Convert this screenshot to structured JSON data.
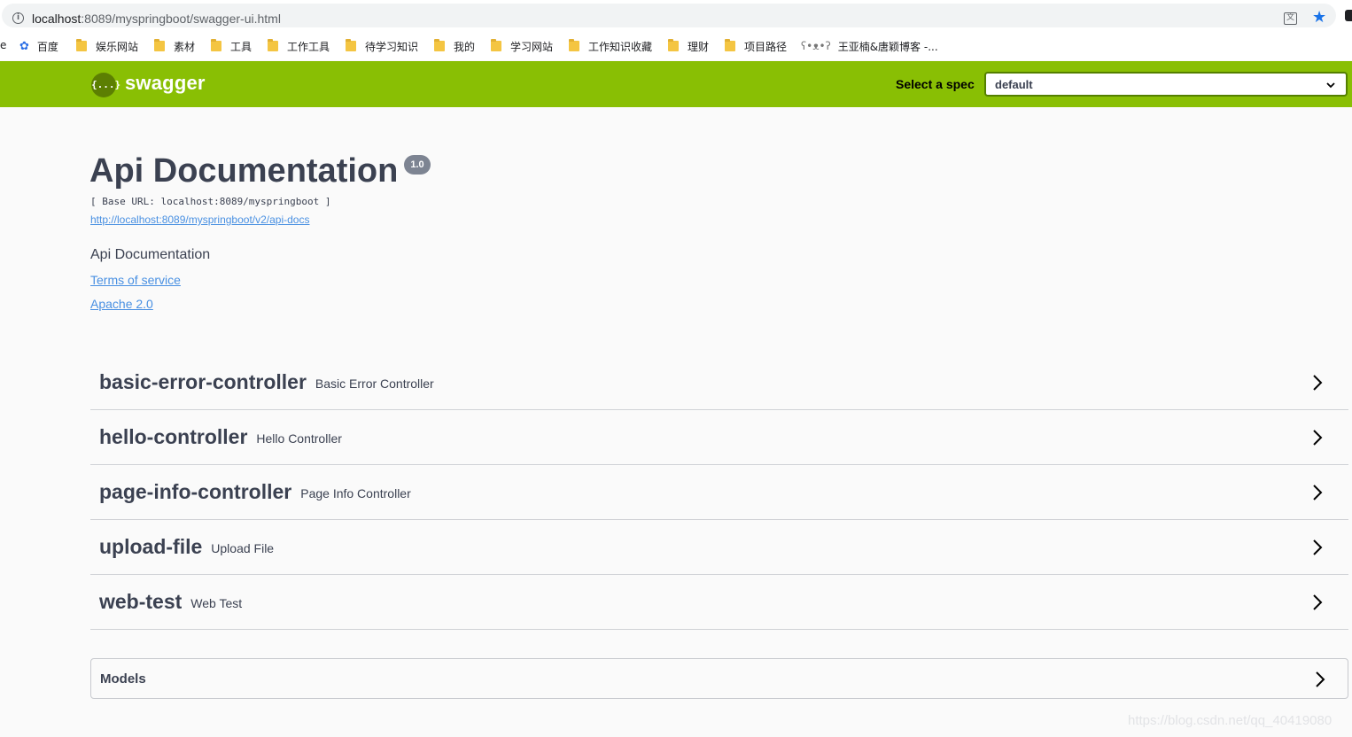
{
  "browser": {
    "url_host": "localhost",
    "url_path": ":8089/myspringboot/swagger-ui.html",
    "bookmark_edge": "e",
    "bookmarks": [
      {
        "label": "百度",
        "icon": "paw-icon"
      },
      {
        "label": "娱乐网站",
        "icon": "folder-icon"
      },
      {
        "label": "素材",
        "icon": "folder-icon"
      },
      {
        "label": "工具",
        "icon": "folder-icon"
      },
      {
        "label": "工作工具",
        "icon": "folder-icon"
      },
      {
        "label": "待学习知识",
        "icon": "folder-icon"
      },
      {
        "label": "我的",
        "icon": "folder-icon"
      },
      {
        "label": "学习网站",
        "icon": "folder-icon"
      },
      {
        "label": "工作知识收藏",
        "icon": "folder-icon"
      },
      {
        "label": "理财",
        "icon": "folder-icon"
      },
      {
        "label": "项目路径",
        "icon": "folder-icon"
      },
      {
        "label": "王亚楠&唐颖博客 -...",
        "icon": "bear-icon"
      }
    ]
  },
  "topbar": {
    "logo_mark": "{...}",
    "logo_text": "swagger",
    "spec_label": "Select a spec",
    "spec_value": "default",
    "bar_color": "#89bf04"
  },
  "info": {
    "title": "Api Documentation",
    "version": "1.0",
    "base_url": "[ Base URL: localhost:8089/myspringboot ]",
    "api_docs_link": "http://localhost:8089/myspringboot/v2/api-docs",
    "description": "Api Documentation",
    "terms_link": "Terms of service",
    "license_link": "Apache 2.0"
  },
  "controllers": [
    {
      "name": "basic-error-controller",
      "description": "Basic Error Controller"
    },
    {
      "name": "hello-controller",
      "description": "Hello Controller"
    },
    {
      "name": "page-info-controller",
      "description": "Page Info Controller"
    },
    {
      "name": "upload-file",
      "description": "Upload File"
    },
    {
      "name": "web-test",
      "description": "Web Test"
    }
  ],
  "models": {
    "label": "Models"
  },
  "watermark": "https://blog.csdn.net/qq_40419080"
}
